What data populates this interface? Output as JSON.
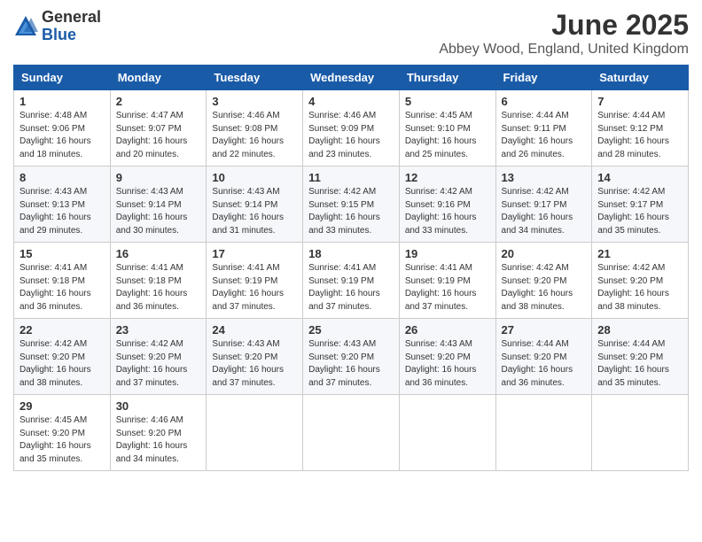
{
  "header": {
    "logo_general": "General",
    "logo_blue": "Blue",
    "main_title": "June 2025",
    "subtitle": "Abbey Wood, England, United Kingdom"
  },
  "weekdays": [
    "Sunday",
    "Monday",
    "Tuesday",
    "Wednesday",
    "Thursday",
    "Friday",
    "Saturday"
  ],
  "weeks": [
    [
      {
        "day": "1",
        "sunrise": "Sunrise: 4:48 AM",
        "sunset": "Sunset: 9:06 PM",
        "daylight": "Daylight: 16 hours and 18 minutes."
      },
      {
        "day": "2",
        "sunrise": "Sunrise: 4:47 AM",
        "sunset": "Sunset: 9:07 PM",
        "daylight": "Daylight: 16 hours and 20 minutes."
      },
      {
        "day": "3",
        "sunrise": "Sunrise: 4:46 AM",
        "sunset": "Sunset: 9:08 PM",
        "daylight": "Daylight: 16 hours and 22 minutes."
      },
      {
        "day": "4",
        "sunrise": "Sunrise: 4:46 AM",
        "sunset": "Sunset: 9:09 PM",
        "daylight": "Daylight: 16 hours and 23 minutes."
      },
      {
        "day": "5",
        "sunrise": "Sunrise: 4:45 AM",
        "sunset": "Sunset: 9:10 PM",
        "daylight": "Daylight: 16 hours and 25 minutes."
      },
      {
        "day": "6",
        "sunrise": "Sunrise: 4:44 AM",
        "sunset": "Sunset: 9:11 PM",
        "daylight": "Daylight: 16 hours and 26 minutes."
      },
      {
        "day": "7",
        "sunrise": "Sunrise: 4:44 AM",
        "sunset": "Sunset: 9:12 PM",
        "daylight": "Daylight: 16 hours and 28 minutes."
      }
    ],
    [
      {
        "day": "8",
        "sunrise": "Sunrise: 4:43 AM",
        "sunset": "Sunset: 9:13 PM",
        "daylight": "Daylight: 16 hours and 29 minutes."
      },
      {
        "day": "9",
        "sunrise": "Sunrise: 4:43 AM",
        "sunset": "Sunset: 9:14 PM",
        "daylight": "Daylight: 16 hours and 30 minutes."
      },
      {
        "day": "10",
        "sunrise": "Sunrise: 4:43 AM",
        "sunset": "Sunset: 9:14 PM",
        "daylight": "Daylight: 16 hours and 31 minutes."
      },
      {
        "day": "11",
        "sunrise": "Sunrise: 4:42 AM",
        "sunset": "Sunset: 9:15 PM",
        "daylight": "Daylight: 16 hours and 33 minutes."
      },
      {
        "day": "12",
        "sunrise": "Sunrise: 4:42 AM",
        "sunset": "Sunset: 9:16 PM",
        "daylight": "Daylight: 16 hours and 33 minutes."
      },
      {
        "day": "13",
        "sunrise": "Sunrise: 4:42 AM",
        "sunset": "Sunset: 9:17 PM",
        "daylight": "Daylight: 16 hours and 34 minutes."
      },
      {
        "day": "14",
        "sunrise": "Sunrise: 4:42 AM",
        "sunset": "Sunset: 9:17 PM",
        "daylight": "Daylight: 16 hours and 35 minutes."
      }
    ],
    [
      {
        "day": "15",
        "sunrise": "Sunrise: 4:41 AM",
        "sunset": "Sunset: 9:18 PM",
        "daylight": "Daylight: 16 hours and 36 minutes."
      },
      {
        "day": "16",
        "sunrise": "Sunrise: 4:41 AM",
        "sunset": "Sunset: 9:18 PM",
        "daylight": "Daylight: 16 hours and 36 minutes."
      },
      {
        "day": "17",
        "sunrise": "Sunrise: 4:41 AM",
        "sunset": "Sunset: 9:19 PM",
        "daylight": "Daylight: 16 hours and 37 minutes."
      },
      {
        "day": "18",
        "sunrise": "Sunrise: 4:41 AM",
        "sunset": "Sunset: 9:19 PM",
        "daylight": "Daylight: 16 hours and 37 minutes."
      },
      {
        "day": "19",
        "sunrise": "Sunrise: 4:41 AM",
        "sunset": "Sunset: 9:19 PM",
        "daylight": "Daylight: 16 hours and 37 minutes."
      },
      {
        "day": "20",
        "sunrise": "Sunrise: 4:42 AM",
        "sunset": "Sunset: 9:20 PM",
        "daylight": "Daylight: 16 hours and 38 minutes."
      },
      {
        "day": "21",
        "sunrise": "Sunrise: 4:42 AM",
        "sunset": "Sunset: 9:20 PM",
        "daylight": "Daylight: 16 hours and 38 minutes."
      }
    ],
    [
      {
        "day": "22",
        "sunrise": "Sunrise: 4:42 AM",
        "sunset": "Sunset: 9:20 PM",
        "daylight": "Daylight: 16 hours and 38 minutes."
      },
      {
        "day": "23",
        "sunrise": "Sunrise: 4:42 AM",
        "sunset": "Sunset: 9:20 PM",
        "daylight": "Daylight: 16 hours and 37 minutes."
      },
      {
        "day": "24",
        "sunrise": "Sunrise: 4:43 AM",
        "sunset": "Sunset: 9:20 PM",
        "daylight": "Daylight: 16 hours and 37 minutes."
      },
      {
        "day": "25",
        "sunrise": "Sunrise: 4:43 AM",
        "sunset": "Sunset: 9:20 PM",
        "daylight": "Daylight: 16 hours and 37 minutes."
      },
      {
        "day": "26",
        "sunrise": "Sunrise: 4:43 AM",
        "sunset": "Sunset: 9:20 PM",
        "daylight": "Daylight: 16 hours and 36 minutes."
      },
      {
        "day": "27",
        "sunrise": "Sunrise: 4:44 AM",
        "sunset": "Sunset: 9:20 PM",
        "daylight": "Daylight: 16 hours and 36 minutes."
      },
      {
        "day": "28",
        "sunrise": "Sunrise: 4:44 AM",
        "sunset": "Sunset: 9:20 PM",
        "daylight": "Daylight: 16 hours and 35 minutes."
      }
    ],
    [
      {
        "day": "29",
        "sunrise": "Sunrise: 4:45 AM",
        "sunset": "Sunset: 9:20 PM",
        "daylight": "Daylight: 16 hours and 35 minutes."
      },
      {
        "day": "30",
        "sunrise": "Sunrise: 4:46 AM",
        "sunset": "Sunset: 9:20 PM",
        "daylight": "Daylight: 16 hours and 34 minutes."
      },
      null,
      null,
      null,
      null,
      null
    ]
  ]
}
